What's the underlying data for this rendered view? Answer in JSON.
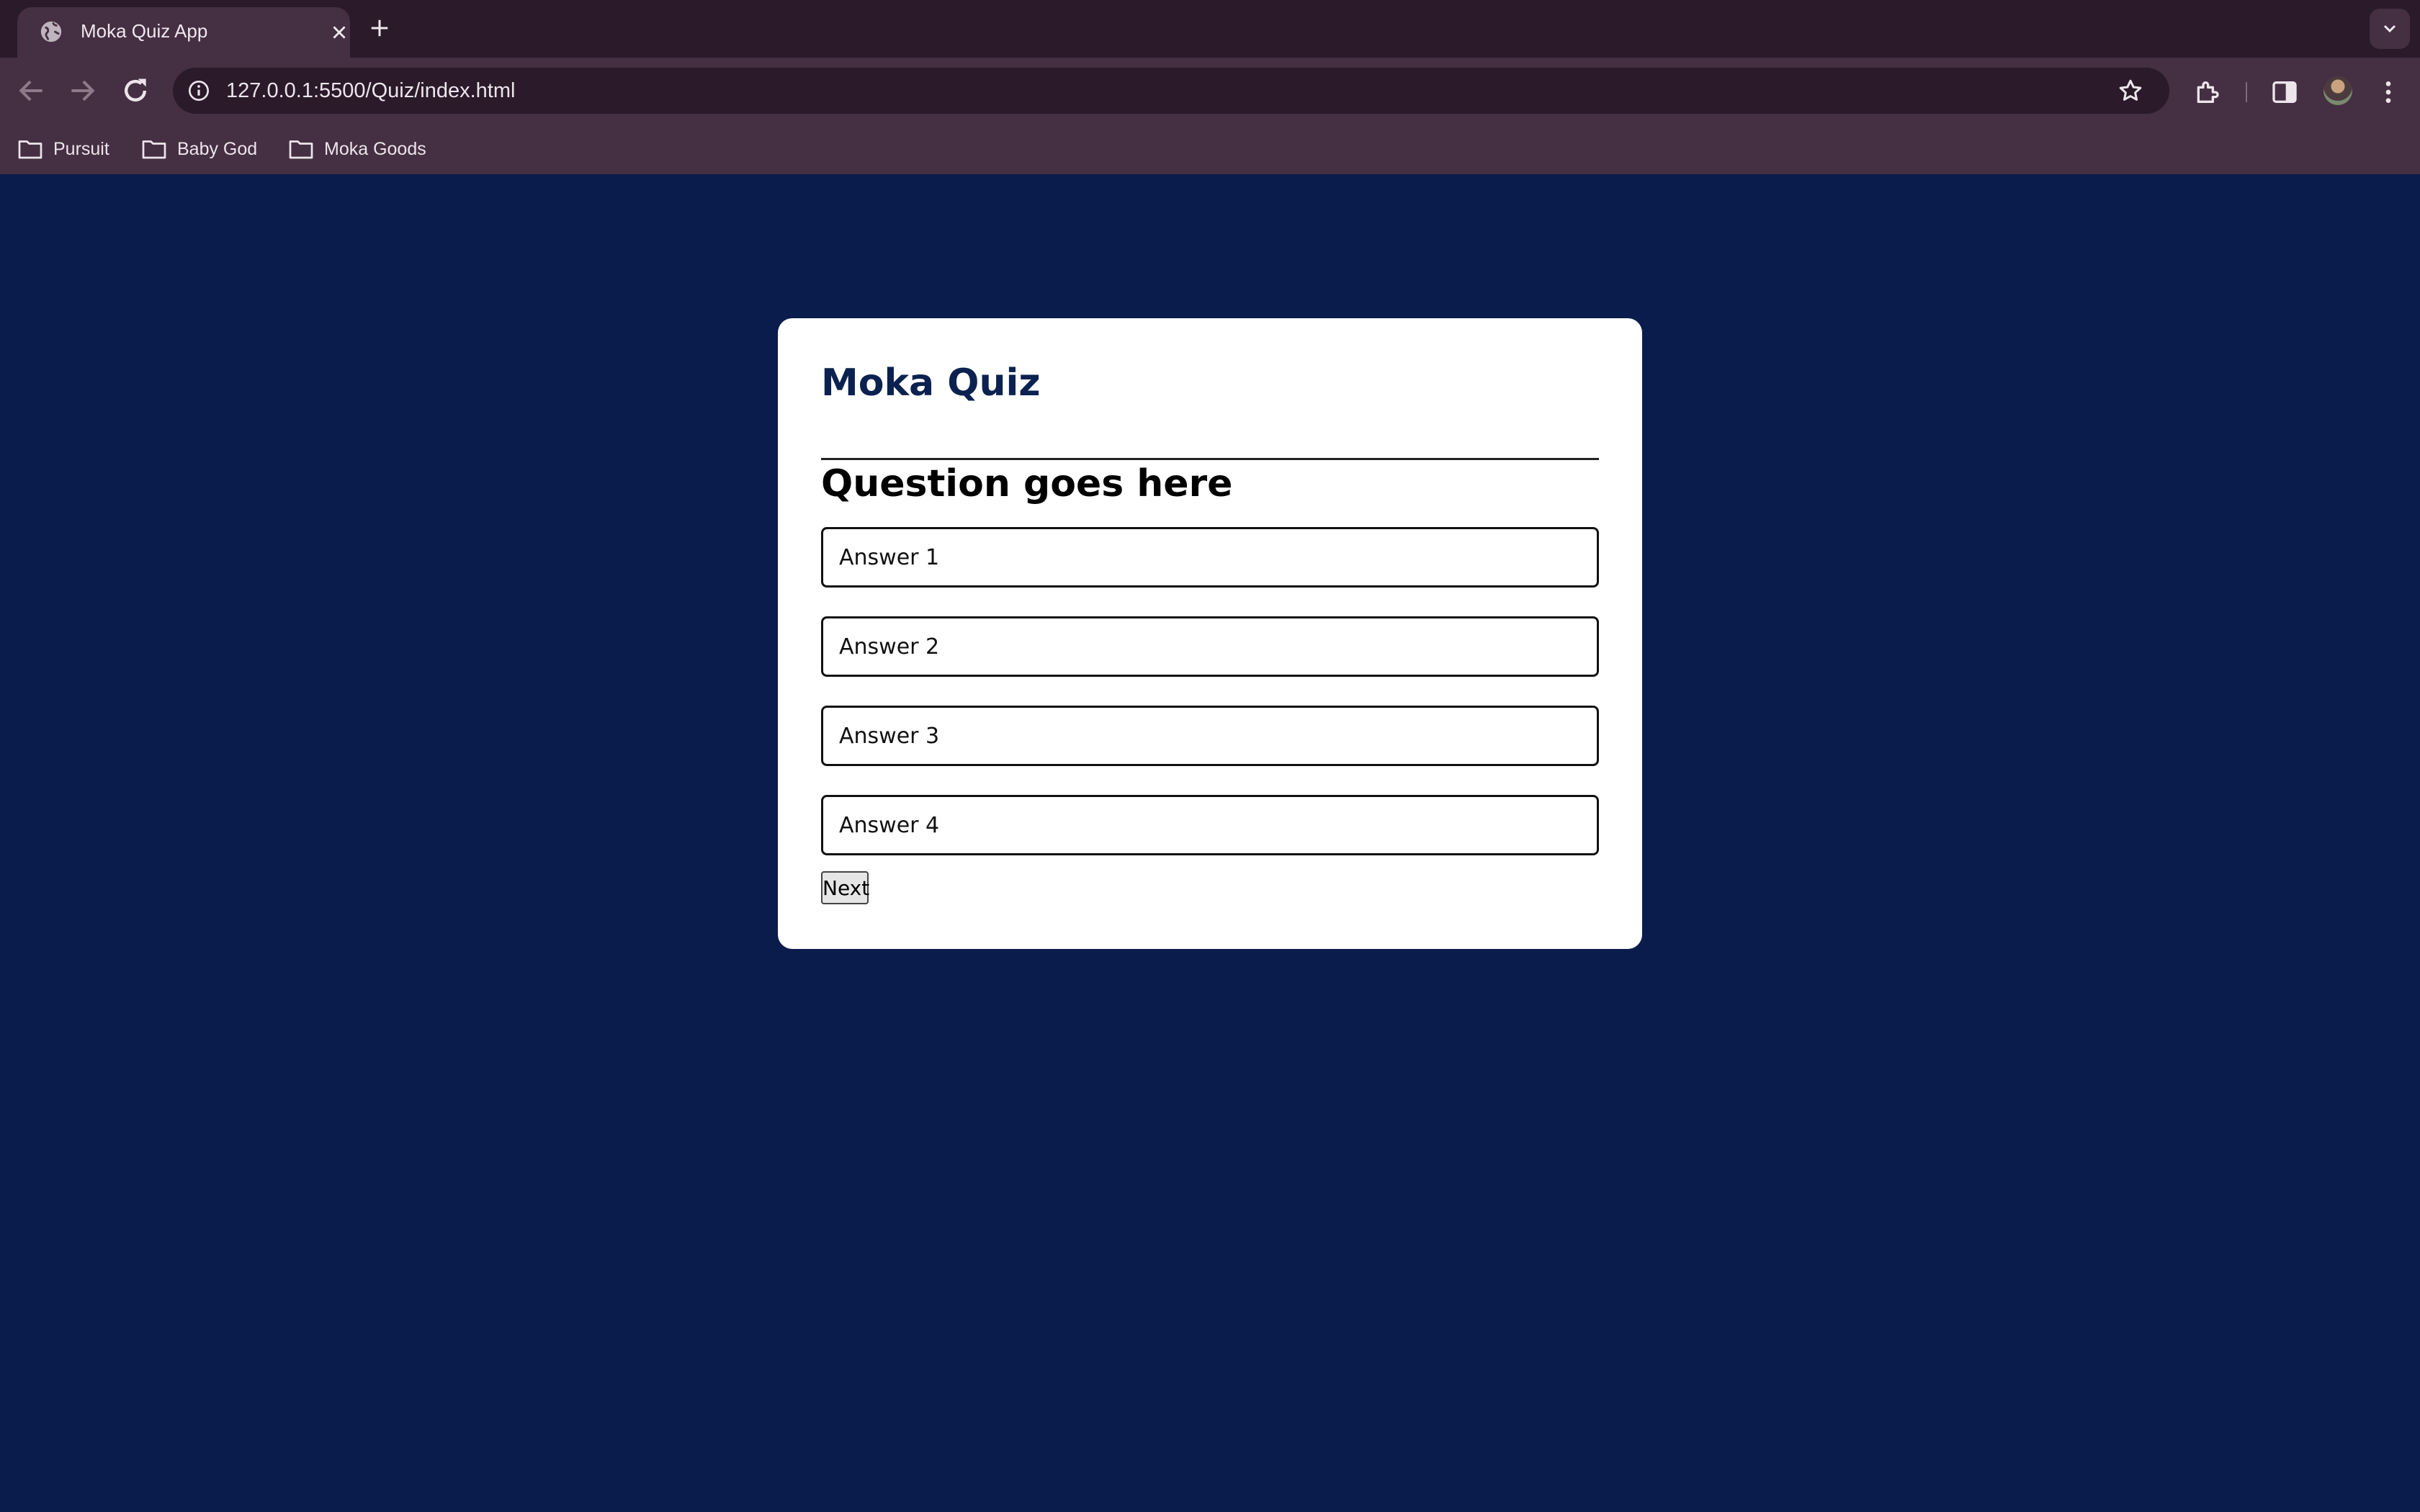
{
  "browser": {
    "tab_title": "Moka Quiz App",
    "url": "127.0.0.1:5500/Quiz/index.html",
    "bookmarks": [
      "Pursuit",
      "Baby God",
      "Moka Goods"
    ],
    "icons": [
      "globe-icon",
      "close-icon",
      "plus-icon",
      "chevron-down-icon",
      "back-arrow-icon",
      "forward-arrow-icon",
      "reload-icon",
      "info-icon",
      "star-icon",
      "extensions-icon",
      "side-panel-icon",
      "avatar",
      "kebab-menu-icon",
      "folder-icon"
    ]
  },
  "quiz": {
    "title": "Moka Quiz",
    "question": "Question goes here",
    "answers": [
      "Answer 1",
      "Answer 2",
      "Answer 3",
      "Answer 4"
    ],
    "next_label": "Next"
  },
  "colors": {
    "page_background": "#091c4b",
    "card_background": "#ffffff",
    "title_color": "#0b2150",
    "chrome_dark": "#2a1a2a",
    "chrome_light": "#452f43"
  }
}
